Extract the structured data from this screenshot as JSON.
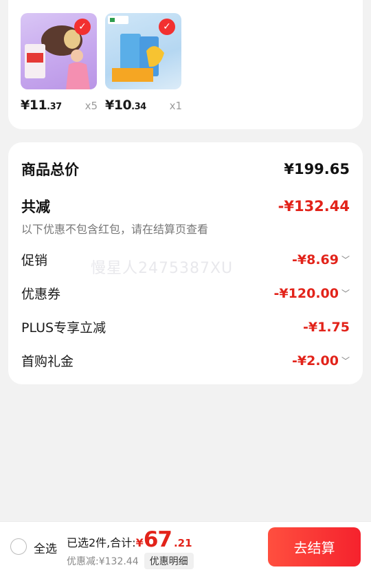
{
  "products": [
    {
      "price_int": "¥11",
      "price_dec": ".37",
      "qty": "x5",
      "selected": true
    },
    {
      "price_int": "¥10",
      "price_dec": ".34",
      "qty": "x1",
      "selected": true
    }
  ],
  "summary": {
    "total_label": "商品总价",
    "total_value": "¥199.65",
    "reduce_label": "共减",
    "reduce_value": "-¥132.44",
    "note": "以下优惠不包含红包，请在结算页查看",
    "items": [
      {
        "label": "促销",
        "value": "-¥8.69",
        "chevron": true
      },
      {
        "label": "优惠券",
        "value": "-¥120.00",
        "chevron": true
      },
      {
        "label": "PLUS专享立减",
        "value": "-¥1.75",
        "chevron": false
      },
      {
        "label": "首购礼金",
        "value": "-¥2.00",
        "chevron": true
      }
    ],
    "watermark": "慢星人2475387XU"
  },
  "bottom_bar": {
    "select_all": "全选",
    "selected_total_prefix": "已选2件,合计:",
    "currency": "¥",
    "total_int": "67",
    "total_dec": ".21",
    "discount_text": "优惠减:¥132.44",
    "detail_button": "优惠明细",
    "checkout_button": "去结算"
  },
  "colors": {
    "accent": "#e2231a",
    "checkout_start": "#ff4f3f",
    "checkout_end": "#f5222d"
  }
}
